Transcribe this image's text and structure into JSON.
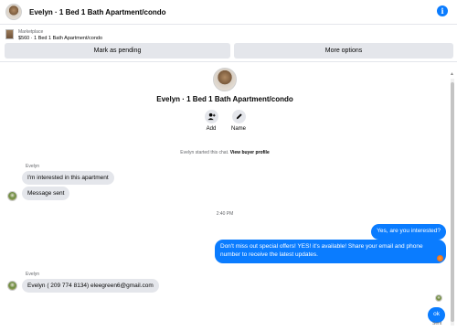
{
  "header": {
    "title": "Evelyn · 1 Bed 1 Bath Apartment/condo",
    "info_icon": "info-icon"
  },
  "listing": {
    "source": "Marketplace",
    "subtitle": "$560 · 1 Bed 1 Bath Apartment/condo"
  },
  "actions": {
    "mark_pending": "Mark as pending",
    "more_options": "More options"
  },
  "profile": {
    "name": "Evelyn · 1 Bed 1 Bath Apartment/condo",
    "add_label": "Add",
    "name_label": "Name",
    "add_icon": "add-person-icon",
    "name_icon": "pencil-icon"
  },
  "chat": {
    "started_text": "Evelyn started this chat.",
    "view_profile": "View buyer profile",
    "sender_1": "Evelyn",
    "msg_1": "I'm interested in this apartment",
    "msg_2": "Message sent",
    "time": "2:40 PM",
    "out_1": "Yes, are you interested?",
    "out_2": "Don't miss out special offers! YES! it's available! Share your email and phone number to receive the latest updates.",
    "sender_2": "Evelyn",
    "msg_3": "Evelyn ( 209 774 8134) eleegreen6@gmail.com",
    "out_3": "ok",
    "status": "Sent"
  },
  "colors": {
    "accent": "#0a7cff",
    "bubble_in": "#e4e6eb"
  }
}
